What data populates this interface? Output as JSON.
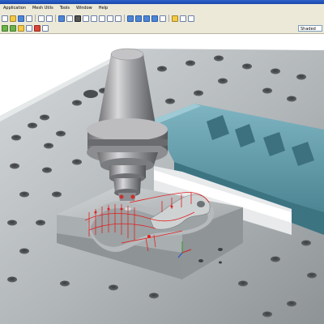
{
  "app": {
    "menu": [
      "Application",
      "Mesh Utils",
      "Tools",
      "Window",
      "Help"
    ]
  },
  "toolbar": {
    "view_mode_value": "Shaded"
  },
  "colors": {
    "title_bar": "#2356c0",
    "chrome": "#ece9d8",
    "table": "#a8adb0",
    "vise_jaw": "#5d98a6",
    "workpiece": "#b9bec0",
    "toolpath": "#e02020"
  },
  "icons": [
    "new-icon",
    "open-icon",
    "save-icon",
    "undo-icon",
    "redo-icon",
    "rotate-icon",
    "zoom-in-icon",
    "zoom-out-icon",
    "fit-icon",
    "pan-icon",
    "shaded-view-icon",
    "wireframe-icon",
    "select-icon",
    "help-icon"
  ]
}
